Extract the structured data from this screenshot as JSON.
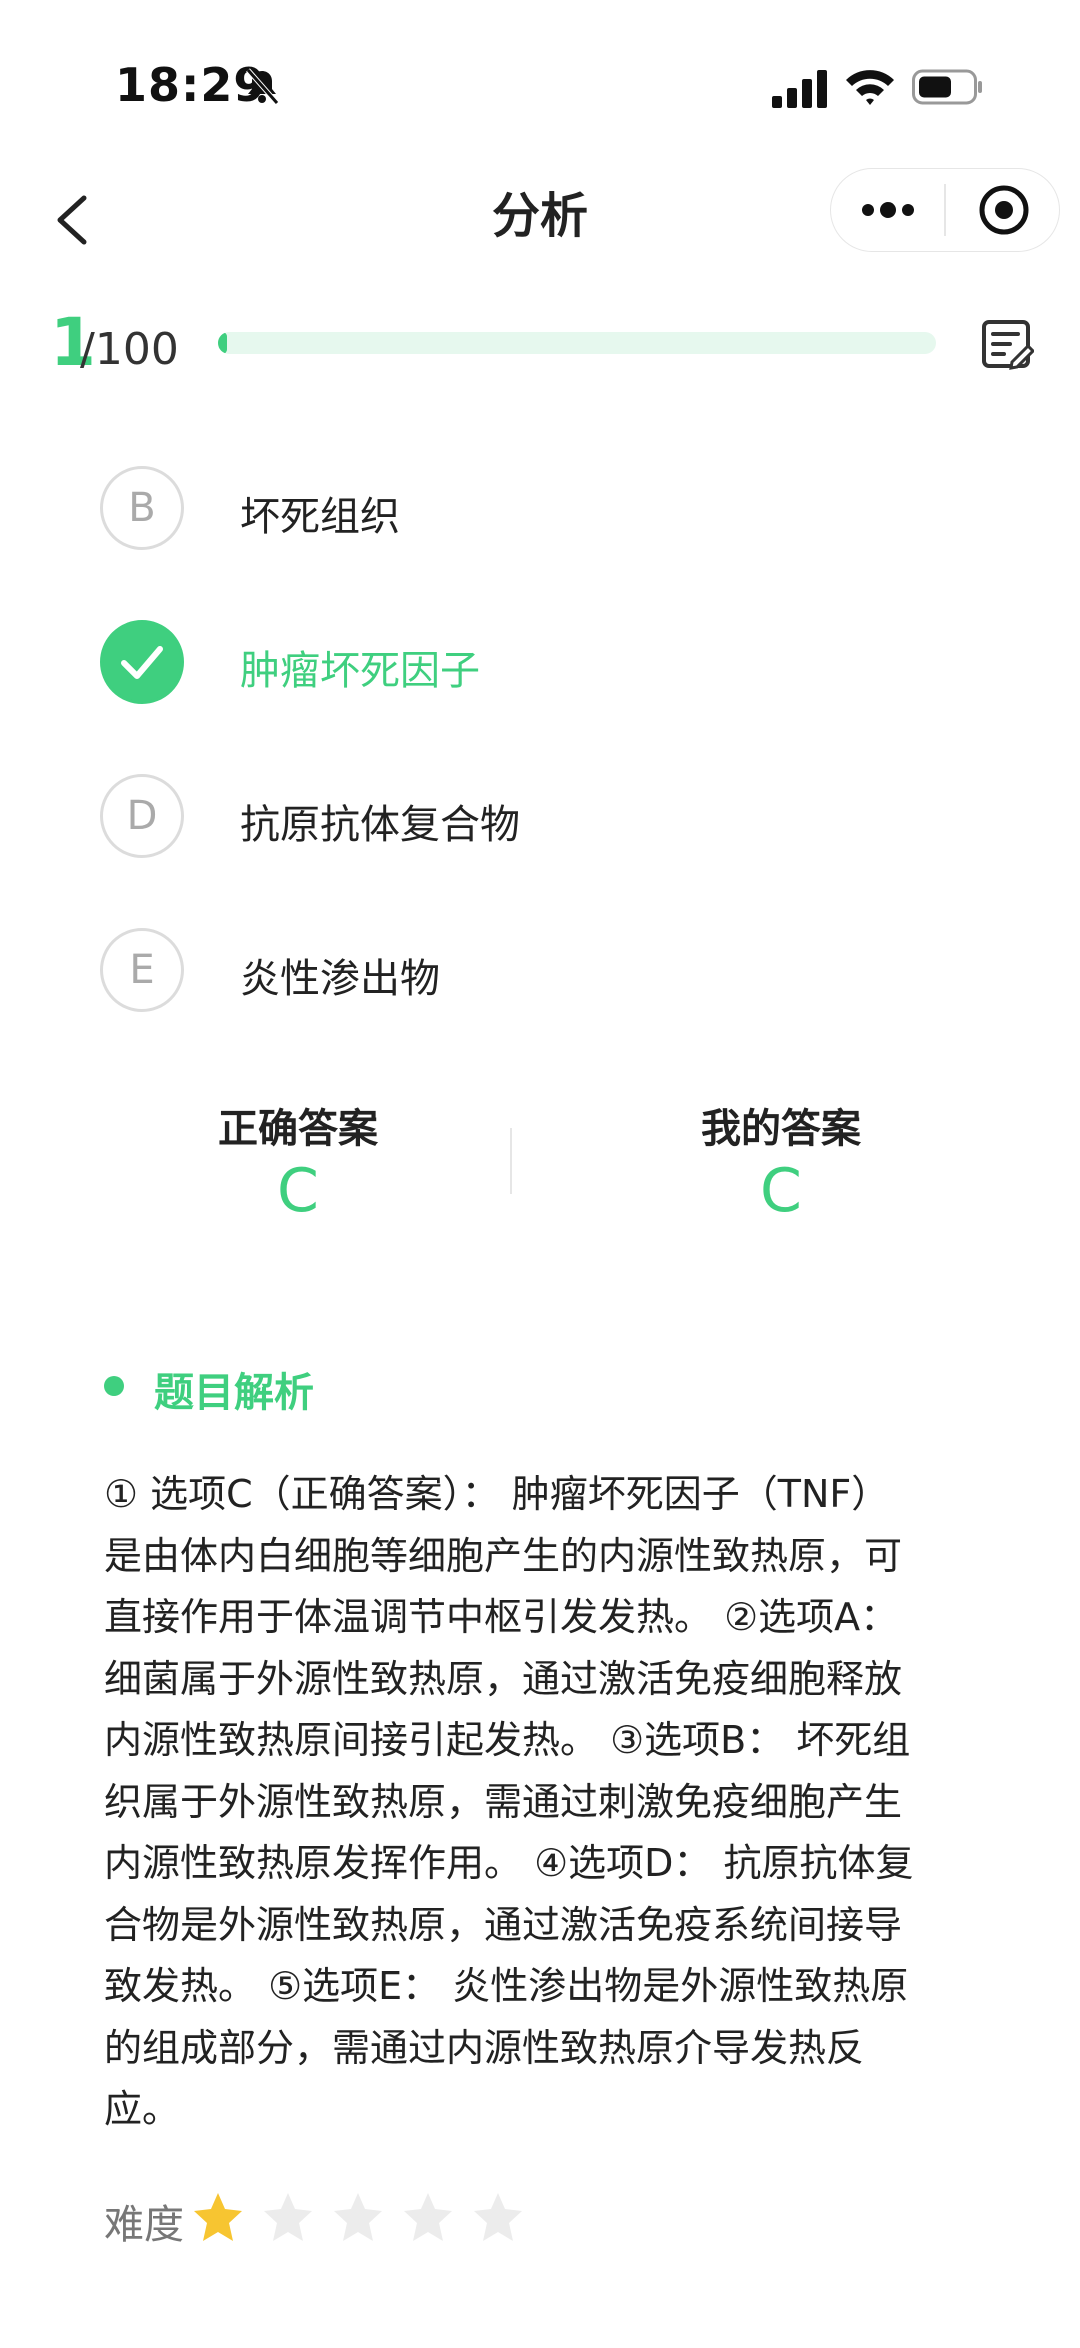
{
  "status_bar": {
    "time": "18:29"
  },
  "nav": {
    "title": "分析"
  },
  "progress": {
    "current": "1",
    "total": "/100",
    "fraction": 0.01
  },
  "options": [
    {
      "letter": "B",
      "text": "坏死组织",
      "correct": false
    },
    {
      "letter": "C",
      "text": "肿瘤坏死因子",
      "correct": true
    },
    {
      "letter": "D",
      "text": "抗原抗体复合物",
      "correct": false
    },
    {
      "letter": "E",
      "text": "炎性渗出物",
      "correct": false
    }
  ],
  "answers": {
    "correct_label": "正确答案",
    "correct_value": "C",
    "mine_label": "我的答案",
    "mine_value": "C"
  },
  "analysis": {
    "title": "题目解析",
    "text": "① 选项C（正确答案）： 肿瘤坏死因子（TNF）\n是由体内白细胞等细胞产生的内源性致热原，可\n直接作用于体温调节中枢引发发热。 ②选项A：\n细菌属于外源性致热原，通过激活免疫细胞释放\n内源性致热原间接引起发热。 ③选项B： 坏死组\n织属于外源性致热原，需通过刺激免疫细胞产生\n内源性致热原发挥作用。 ④选项D： 抗原抗体复\n合物是外源性致热原，通过激活免疫系统间接导\n致发热。 ⑤选项E： 炎性渗出物是外源性致热原\n的组成部分，需通过内源性致热原介导发热反\n应。"
  },
  "difficulty": {
    "label": "难度",
    "rating": 1,
    "max": 5
  },
  "colors": {
    "accent": "#3fcf7f",
    "star_on": "#f7c531",
    "star_off": "#ececec"
  }
}
